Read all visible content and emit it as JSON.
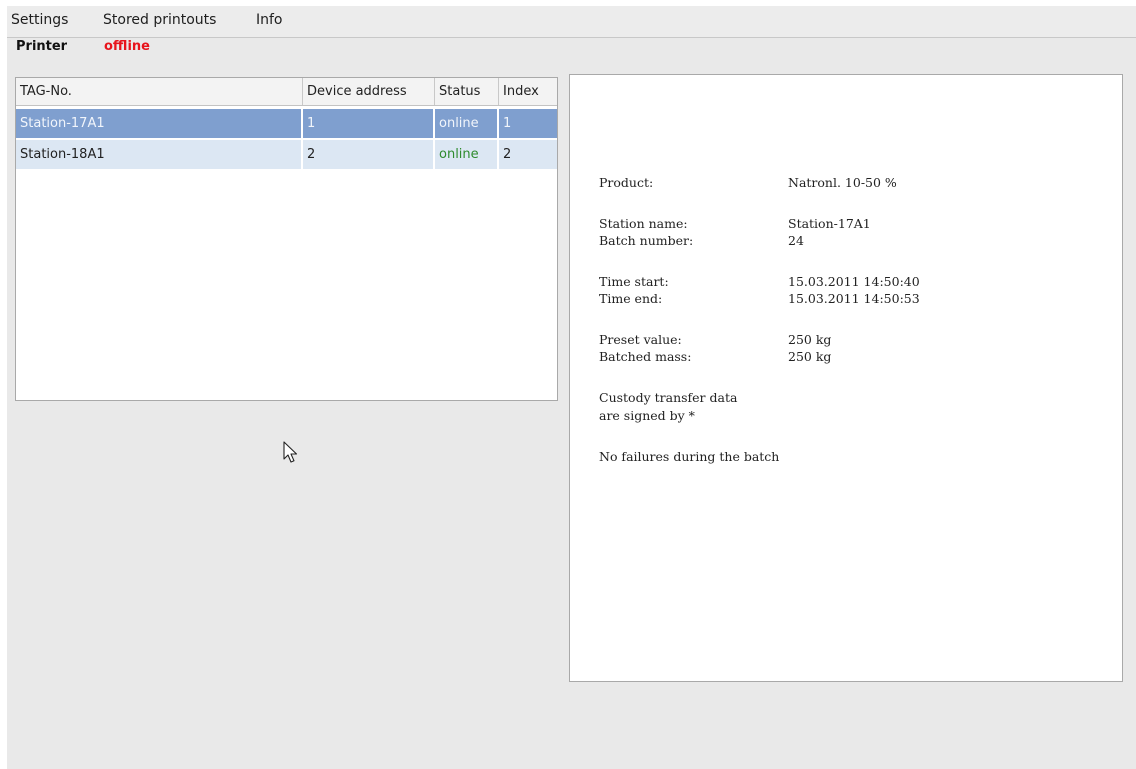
{
  "menu": {
    "items": [
      "Settings",
      "Stored printouts",
      "Info"
    ]
  },
  "printer": {
    "label": "Printer",
    "status": "offline",
    "status_color": "#e8141c"
  },
  "table": {
    "columns": [
      "TAG-No.",
      "Device address",
      "Status",
      "Index"
    ],
    "rows": [
      {
        "tag": "Station-17A1",
        "address": "1",
        "status": "online",
        "index": "1",
        "selected": true
      },
      {
        "tag": "Station-18A1",
        "address": "2",
        "status": "online",
        "index": "2",
        "selected": false
      }
    ],
    "selected_row_color": "#7f9fcf",
    "row_color": "#dce7f3",
    "online_color": "#2e8b2e"
  },
  "printout": {
    "product_label": "Product:",
    "product_value": "Natronl. 10-50 %",
    "station_label": "Station name:",
    "station_value": "Station-17A1",
    "batch_label": "Batch number:",
    "batch_value": "24",
    "start_label": "Time start:",
    "start_value": "15.03.2011 14:50:40",
    "end_label": "Time end:",
    "end_value": "15.03.2011 14:50:53",
    "preset_label": "Preset value:",
    "preset_value": "250 kg",
    "mass_label": "Batched mass:",
    "mass_value": "250 kg",
    "custody_line1": "Custody transfer data",
    "custody_line2": "are signed by *",
    "failures_line": "No failures during the batch"
  }
}
